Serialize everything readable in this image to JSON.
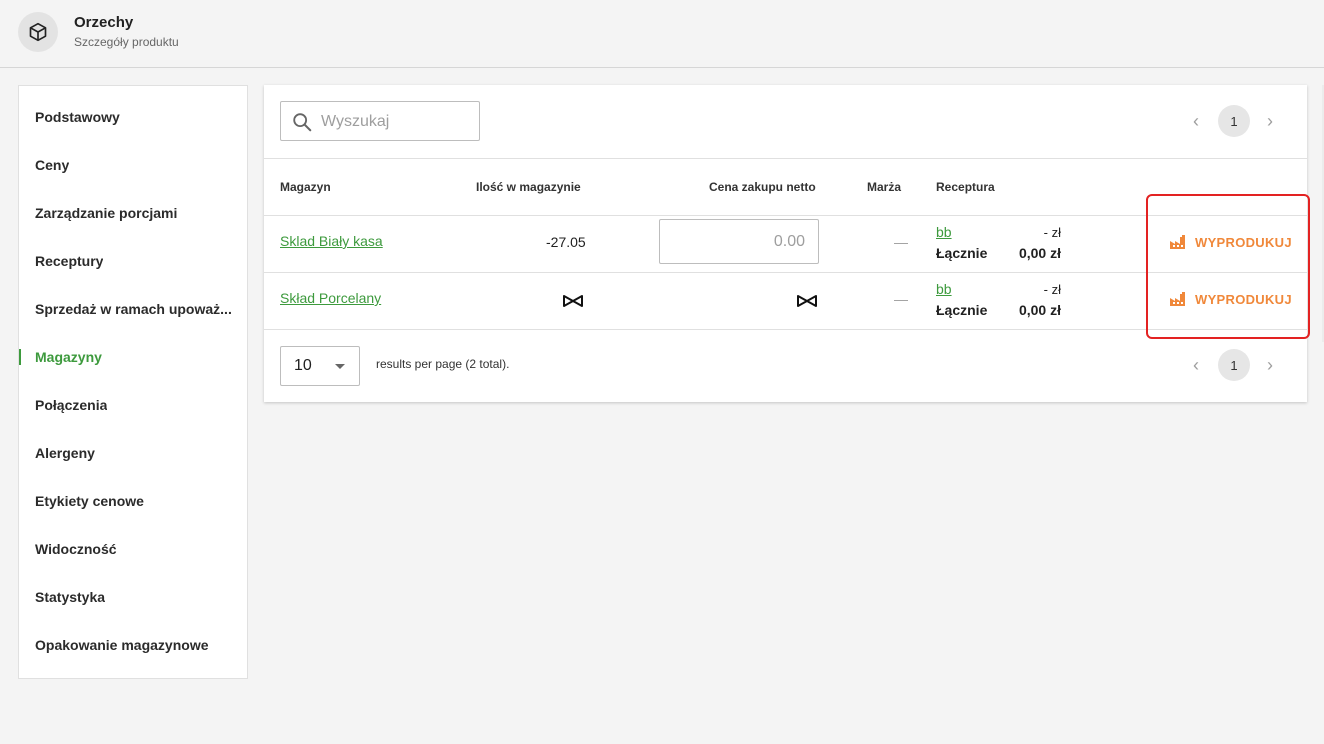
{
  "header": {
    "title": "Orzechy",
    "subtitle": "Szczegóły produktu",
    "icon": "box-icon"
  },
  "sidebar": {
    "items": [
      {
        "label": "Podstawowy",
        "active": false
      },
      {
        "label": "Ceny",
        "active": false
      },
      {
        "label": "Zarządzanie porcjami",
        "active": false
      },
      {
        "label": "Receptury",
        "active": false
      },
      {
        "label": "Sprzedaż w ramach upoważ...",
        "active": false
      },
      {
        "label": "Magazyny",
        "active": true
      },
      {
        "label": "Połączenia",
        "active": false
      },
      {
        "label": "Alergeny",
        "active": false
      },
      {
        "label": "Etykiety cenowe",
        "active": false
      },
      {
        "label": "Widoczność",
        "active": false
      },
      {
        "label": "Statystyka",
        "active": false
      },
      {
        "label": "Opakowanie magazynowe",
        "active": false
      }
    ]
  },
  "search": {
    "placeholder": "Wyszukaj",
    "value": ""
  },
  "pagination": {
    "current_page": "1"
  },
  "table": {
    "columns": [
      "Magazyn",
      "Ilość w magazynie",
      "Cena zakupu netto",
      "Marża",
      "Receptura"
    ],
    "rows": [
      {
        "warehouse": "Sklad Biały kasa",
        "quantity": "-27.05",
        "price_placeholder": "0.00",
        "margin": "—",
        "recipe_link": "bb",
        "recipe_price": "- zł",
        "total_label": "Łącznie",
        "total_value": "0,00 zł",
        "action": "WYPRODUKUJ"
      },
      {
        "warehouse": "Skład Porcelany",
        "quantity": "∞",
        "price": "∞",
        "margin": "—",
        "recipe_link": "bb",
        "recipe_price": "- zł",
        "total_label": "Łącznie",
        "total_value": "0,00 zł",
        "action": "WYPRODUKUJ"
      }
    ]
  },
  "footer": {
    "per_page": "10",
    "per_page_text": "results per page (2 total)."
  },
  "colors": {
    "accent_green": "#3d9a3d",
    "action_orange": "#f0883a",
    "highlight_red": "#e32222"
  }
}
